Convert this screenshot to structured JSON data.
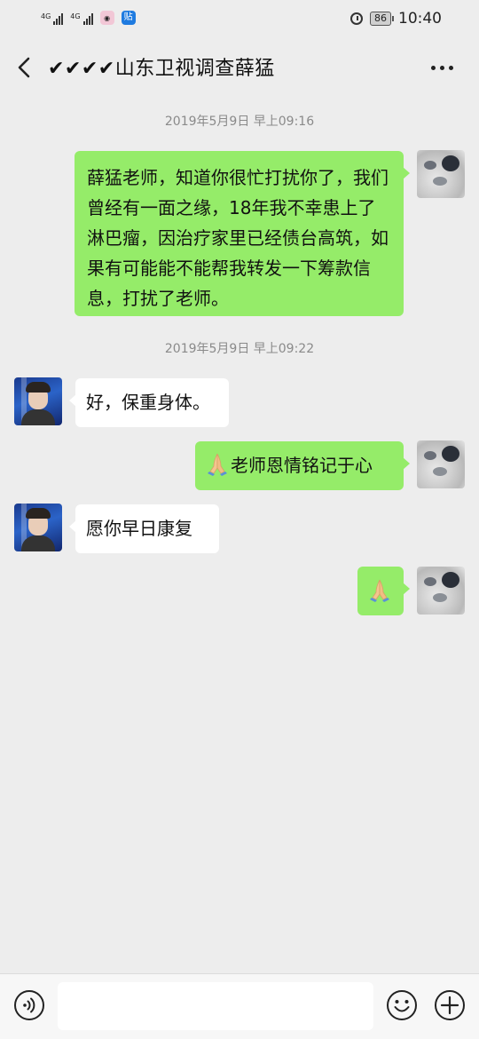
{
  "status_bar": {
    "network_1": "4G",
    "network_2": "4G",
    "app_icon_b_text": "贴",
    "battery": "86",
    "time": "10:40"
  },
  "nav": {
    "title": "✔✔✔✔山东卫视调查薛猛"
  },
  "timestamps": [
    "2019年5月9日 早上09:16",
    "2019年5月9日 早上09:22"
  ],
  "messages": [
    {
      "side": "mine",
      "text": "薛猛老师，知道你很忙打扰你了，我们曾经有一面之缘，18年我不幸患上了淋巴瘤，因治疗家里已经债台高筑，如果有可能能不能帮我转发一下筹款信息，打扰了老师。"
    },
    {
      "side": "theirs",
      "text": "好，保重身体。"
    },
    {
      "side": "mine",
      "emoji": "folded-hands",
      "text": "老师恩情铭记于心"
    },
    {
      "side": "theirs",
      "text": "愿你早日康复"
    },
    {
      "side": "mine",
      "emoji": "folded-hands",
      "text": ""
    }
  ],
  "colors": {
    "background": "#ededed",
    "bubble_mine": "#95ec69",
    "bubble_theirs": "#ffffff",
    "timestamp_text": "#8a8a8a"
  },
  "input": {
    "value": "",
    "placeholder": ""
  },
  "icons": [
    "back-arrow-icon",
    "more-dots-icon",
    "voice-icon",
    "emoji-icon",
    "plus-icon",
    "folded-hands-icon",
    "alarm-icon",
    "battery-icon"
  ]
}
